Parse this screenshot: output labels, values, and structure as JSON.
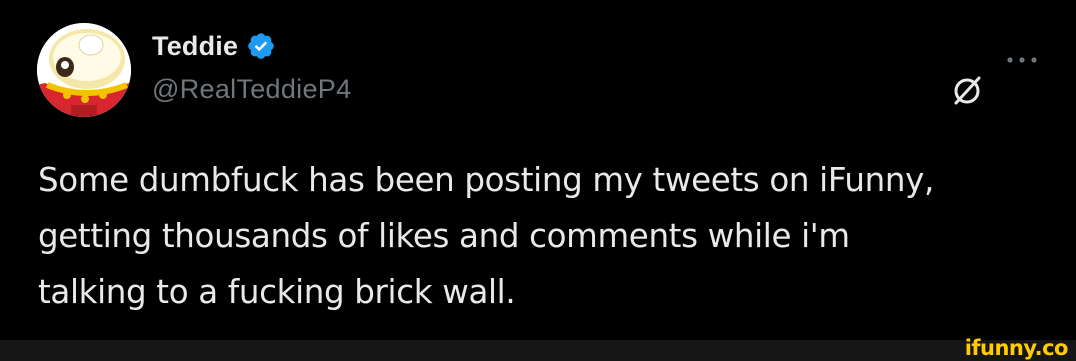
{
  "tweet": {
    "author": {
      "display_name": "Teddie",
      "handle": "@RealTeddieP4",
      "verified": true,
      "avatar_icon": "teddie-avatar",
      "verified_color": "#1d9bf0"
    },
    "text": "Some dumbfuck has been posting my tweets on iFunny,\ngetting thousands of likes and comments while i'm\ntalking to a fucking brick wall.",
    "actions": {
      "grok_icon": "grok-icon",
      "more_icon": "more-icon"
    }
  },
  "watermark": {
    "text": "ifunny.co",
    "color": "#ffcc00"
  },
  "colors": {
    "background": "#000000",
    "primary_text": "#e7e9ea",
    "secondary_text": "#71767b"
  }
}
